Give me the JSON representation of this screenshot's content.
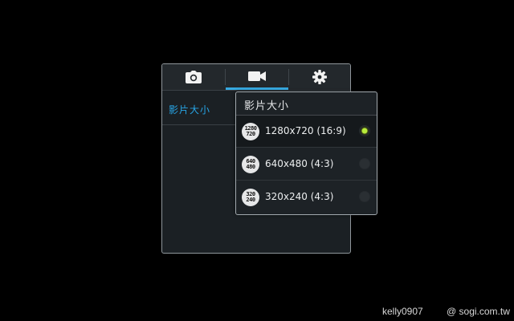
{
  "tabs": [
    {
      "name": "camera",
      "icon": "camera-icon"
    },
    {
      "name": "video",
      "icon": "video-camera-icon",
      "active": true
    },
    {
      "name": "settings",
      "icon": "gear-icon"
    }
  ],
  "sidebar": {
    "item_label": "影片大小"
  },
  "popup": {
    "title": "影片大小",
    "options": [
      {
        "icon_top": "1280",
        "icon_bottom": "720",
        "label": "1280x720 (16:9)",
        "selected": true
      },
      {
        "icon_top": "640",
        "icon_bottom": "480",
        "label": "640x480 (4:3)",
        "selected": false
      },
      {
        "icon_top": "320",
        "icon_bottom": "240",
        "label": "320x240 (4:3)",
        "selected": false
      }
    ]
  },
  "watermark": {
    "user": "kelly0907",
    "site": "@ sogi.com.tw"
  },
  "colors": {
    "accent": "#27a5e6",
    "selected_radio": "#b8ec3a"
  }
}
